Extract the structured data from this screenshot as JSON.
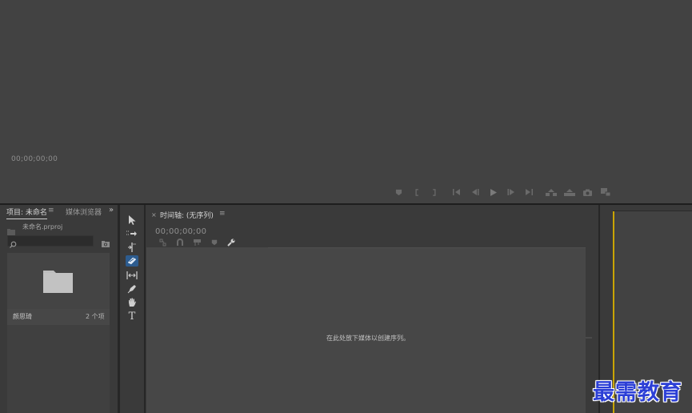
{
  "source_monitor": {
    "timecode": "00;00;00;00",
    "transport_buttons": [
      {
        "name": "add-marker-icon",
        "glyph": "♥"
      },
      {
        "name": "mark-in-icon",
        "glyph": "{"
      },
      {
        "name": "mark-out-icon",
        "glyph": "}"
      },
      {
        "name": "go-to-in-icon",
        "glyph": "|◀"
      },
      {
        "name": "step-back-icon",
        "glyph": "◀|"
      },
      {
        "name": "play-icon",
        "glyph": "▶"
      },
      {
        "name": "step-forward-icon",
        "glyph": "|▶"
      },
      {
        "name": "go-to-out-icon",
        "glyph": "▶|"
      },
      {
        "name": "insert-icon",
        "glyph": "insert"
      },
      {
        "name": "overwrite-icon",
        "glyph": "overwrite"
      },
      {
        "name": "export-frame-icon",
        "glyph": "camera"
      },
      {
        "name": "button-editor-icon",
        "glyph": "+"
      }
    ]
  },
  "project_panel": {
    "tab_project": "项目: 未命名",
    "tab_menu": "≡",
    "tab_media_browser": "媒体浏览器",
    "overflow": "»",
    "filename": "未命名.prproj",
    "search_placeholder": "",
    "bin": {
      "name": "颜思琦",
      "count": "2 个项"
    }
  },
  "tools": [
    {
      "name": "selection-tool-icon"
    },
    {
      "name": "track-select-tool-icon"
    },
    {
      "name": "ripple-edit-tool-icon"
    },
    {
      "name": "razor-tool-icon"
    },
    {
      "name": "slip-tool-icon"
    },
    {
      "name": "pen-tool-icon"
    },
    {
      "name": "hand-tool-icon"
    },
    {
      "name": "type-tool-icon",
      "glyph": "T"
    }
  ],
  "timeline": {
    "close_glyph": "×",
    "title": "时间轴: (无序列)",
    "menu": "≡",
    "timecode": "00;00;00;00",
    "empty_hint": "在此处放下媒体以创建序列。"
  },
  "watermark": "最需教育",
  "colors": {
    "panel_bg": "#3a3a3a",
    "monitor_bg": "#424242",
    "selected_tool": "#2d5c8f",
    "playhead_yellow": "#c9a400",
    "watermark_blue": "#2c3fd6"
  }
}
